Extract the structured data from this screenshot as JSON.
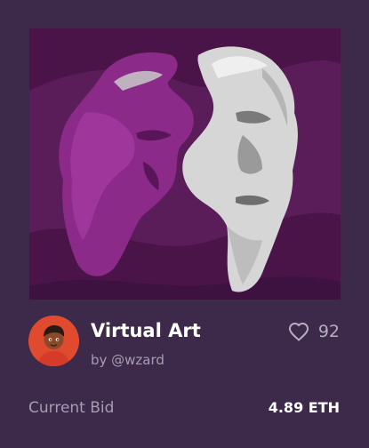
{
  "card": {
    "title": "Virtual Art",
    "author": "by @wzard",
    "likes": "92",
    "bid_label": "Current Bid",
    "bid_value": "4.89 ETH"
  },
  "icons": {
    "like": "heart-outline-icon",
    "avatar": "user-avatar"
  },
  "colors": {
    "background": "#3d2a4a",
    "artwork_bg": "#5c1f5a",
    "artwork_dark": "#3e1240",
    "avatar_bg": "#e04a2f",
    "text_primary": "#ffffff",
    "text_muted": "#a89cb2"
  }
}
